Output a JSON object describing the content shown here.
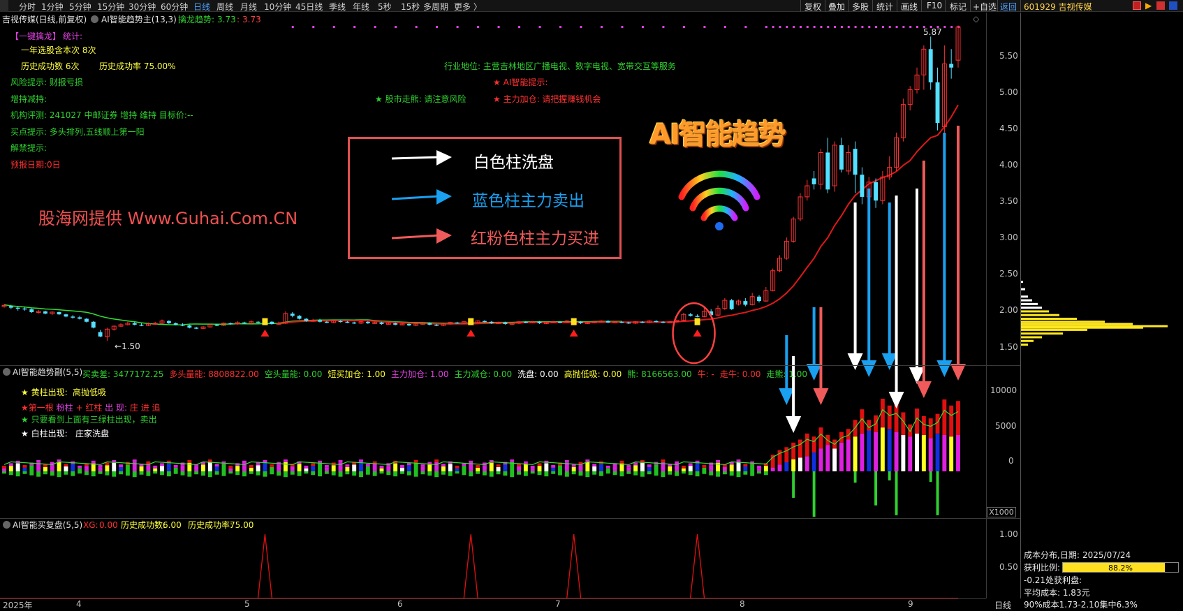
{
  "top_toolbar": {
    "periods": [
      "分时",
      "1分钟",
      "5分钟",
      "15分钟",
      "30分钟",
      "60分钟",
      "日线",
      "周线",
      "月线",
      "10分钟",
      "45日线",
      "季线",
      "年线",
      "5秒",
      "15秒",
      "多周期",
      "更多 〉"
    ],
    "active_period": "日线",
    "right_buttons": [
      "复权",
      "叠加",
      "多股",
      "统计",
      "画线",
      "F10",
      "标记",
      "+自选",
      "返回"
    ],
    "stock_code_name": "601929 吉视传媒"
  },
  "main_chart": {
    "title": "吉视传媒(日线,前复权)",
    "indicator": "AI智能趋势主(13,3)",
    "indicator_label": "擒龙趋势:",
    "indicator_val1": "3.73",
    "indicator_val2": "3.73",
    "high_label": "5.87",
    "low_label": "1.50",
    "y_ticks": [
      "5.50",
      "5.00",
      "4.50",
      "4.00",
      "3.50",
      "3.00",
      "2.50",
      "2.00",
      "1.50"
    ],
    "info_lines": {
      "oneclick": "【一键擒龙】",
      "stats": "统计:",
      "year_count": "一年选股含本次 8次",
      "success_count": "历史成功数 6次",
      "success_rate": "历史成功率 75.00%",
      "risk": "风险提示: 财报亏损",
      "holding": "增持减持:",
      "rating": "机构评测: 241027 中邮证券 增持 维持 目标价:--",
      "buy_tip": "买点提示: 多头排列,五线顺上第一阳",
      "unlock": "解禁提示:",
      "report": "预报日期:0日",
      "industry": "行业地位: 主营吉林地区广播电视、数字电视、宽带交互等服务",
      "ai_tip": "★ AI智能提示:",
      "trend": "★ 股市走熊: 请注意风险",
      "main_force": "★ 主力加仓: 请把握赚钱机会"
    },
    "watermark": "股海网提供 Www.Guhai.Com.CN",
    "big_title": "AI智能趋势",
    "legend": {
      "white": "白色柱洗盘",
      "blue": "蓝色柱主力卖出",
      "red": "红粉色柱主力买进"
    }
  },
  "sub_chart1": {
    "title": "AI智能趋势副(5,5)",
    "items": [
      {
        "label": "买卖差:",
        "value": "3477172.25",
        "color": "#30d030"
      },
      {
        "label": "多头量能:",
        "value": "8808822.00",
        "color": "#ff3030"
      },
      {
        "label": "空头量能:",
        "value": "0.00",
        "color": "#30d030"
      },
      {
        "label": "短买加仓:",
        "value": "1.00",
        "color": "#ffff30"
      },
      {
        "label": "主力加仓:",
        "value": "1.00",
        "color": "#e040e0"
      },
      {
        "label": "主力减仓:",
        "value": "0.00",
        "color": "#30d030"
      },
      {
        "label": "洗盘:",
        "value": "0.00",
        "color": "#ffffff"
      },
      {
        "label": "高抛低吸:",
        "value": "0.00",
        "color": "#ffff30"
      },
      {
        "label": "熊:",
        "value": "8166563.00",
        "color": "#30d030"
      },
      {
        "label": "牛:",
        "value": "-",
        "color": "#ff3030"
      },
      {
        "label": "走牛:",
        "value": "0.00",
        "color": "#ff3030"
      },
      {
        "label": "走熊:",
        "value": "1.00",
        "color": "#30d030"
      }
    ],
    "notes": {
      "n1_label": "★ 黄柱出现:",
      "n1_text": "高抛低吸",
      "n2_a": "★第一根",
      "n2_b": "粉柱",
      "n2_c": "+",
      "n2_d": "红柱",
      "n2_e": "出 现:",
      "n2_f": "庄",
      "n2_g": "进",
      "n2_h": "追",
      "n3": "★ 只要看到上面有三绿柱出现，卖出",
      "n4_label": "★ 白柱出现:",
      "n4_text": "庄家洗盘"
    },
    "y_ticks": [
      "10000",
      "5000",
      "0"
    ],
    "unit": "X1000"
  },
  "sub_chart2": {
    "title": "AI智能买复盘(5,5)",
    "xg_label": "XG:",
    "xg_value": "0.00",
    "succ_label": "历史成功数:",
    "succ_value": "6.00",
    "rate_label": "历史成功率:",
    "rate_value": "75.00",
    "y_ticks": [
      "1.00",
      "0.50"
    ]
  },
  "x_axis": {
    "labels": [
      "2025年",
      "4",
      "5",
      "6",
      "7",
      "8",
      "9"
    ],
    "period_button": "日线"
  },
  "right_panel": {
    "title_label": "成本分布,日期:",
    "date": "2025/07/24",
    "profit_label": "获利比例:",
    "profit_value": "88.2%",
    "profit_ratio": 0.882,
    "profit_price": "-0.21处获利盘:",
    "avg_cost": "平均成本: 1.83元",
    "cost90": "90%成本1.73-2.10集中6.3%"
  },
  "chart_data": {
    "type": "candlestick",
    "y_range": [
      1.3,
      5.95
    ],
    "candles": [
      [
        2.08,
        2.08,
        2.1,
        2.05
      ],
      [
        2.07,
        2.05,
        2.09,
        2.03
      ],
      [
        2.05,
        2.04,
        2.07,
        2.01
      ],
      [
        2.04,
        2.03,
        2.06,
        2.01
      ],
      [
        2.03,
        1.99,
        2.04,
        1.98
      ],
      [
        1.99,
        2.0,
        2.02,
        1.97
      ],
      [
        2.0,
        1.97,
        2.01,
        1.96
      ],
      [
        1.97,
        1.99,
        2.0,
        1.95
      ],
      [
        1.99,
        1.96,
        2.0,
        1.95
      ],
      [
        1.96,
        1.93,
        1.97,
        1.92
      ],
      [
        1.93,
        1.92,
        1.95,
        1.9
      ],
      [
        1.92,
        1.9,
        1.94,
        1.89
      ],
      [
        1.9,
        1.86,
        1.91,
        1.85
      ],
      [
        1.86,
        1.78,
        1.87,
        1.77
      ],
      [
        1.72,
        1.66,
        1.75,
        1.65
      ],
      [
        1.66,
        1.76,
        1.78,
        1.6
      ],
      [
        1.76,
        1.8,
        1.81,
        1.74
      ],
      [
        1.8,
        1.82,
        1.84,
        1.79
      ],
      [
        1.82,
        1.84,
        1.86,
        1.81
      ],
      [
        1.84,
        1.82,
        1.86,
        1.81
      ],
      [
        1.82,
        1.81,
        1.84,
        1.8
      ],
      [
        1.81,
        1.83,
        1.85,
        1.8
      ],
      [
        1.83,
        1.84,
        1.86,
        1.82
      ],
      [
        1.84,
        1.87,
        1.89,
        1.83
      ],
      [
        1.87,
        1.84,
        1.88,
        1.83
      ],
      [
        1.84,
        1.82,
        1.85,
        1.81
      ],
      [
        1.82,
        1.81,
        1.84,
        1.8
      ],
      [
        1.81,
        1.78,
        1.82,
        1.77
      ],
      [
        1.78,
        1.77,
        1.79,
        1.76
      ],
      [
        1.77,
        1.79,
        1.8,
        1.76
      ],
      [
        1.79,
        1.82,
        1.83,
        1.78
      ],
      [
        1.82,
        1.81,
        1.83,
        1.8
      ],
      [
        1.81,
        1.84,
        1.85,
        1.8
      ],
      [
        1.84,
        1.83,
        1.85,
        1.82
      ],
      [
        1.83,
        1.85,
        1.87,
        1.82
      ],
      [
        1.85,
        1.84,
        1.86,
        1.83
      ],
      [
        1.84,
        1.86,
        1.88,
        1.83
      ],
      [
        1.86,
        1.85,
        1.87,
        1.84
      ],
      [
        1.85,
        1.86,
        1.88,
        1.84
      ],
      [
        1.86,
        1.83,
        1.87,
        1.82
      ],
      [
        1.83,
        1.84,
        1.86,
        1.82
      ],
      [
        1.84,
        1.97,
        2.0,
        1.83
      ],
      [
        1.97,
        1.94,
        1.99,
        1.92
      ],
      [
        1.94,
        1.9,
        1.95,
        1.89
      ],
      [
        1.9,
        1.87,
        1.91,
        1.86
      ],
      [
        1.87,
        1.88,
        1.9,
        1.86
      ],
      [
        1.88,
        1.86,
        1.9,
        1.85
      ],
      [
        1.86,
        1.85,
        1.87,
        1.84
      ],
      [
        1.85,
        1.87,
        1.88,
        1.84
      ],
      [
        1.87,
        1.86,
        1.88,
        1.85
      ],
      [
        1.86,
        1.85,
        1.87,
        1.84
      ],
      [
        1.85,
        1.84,
        1.86,
        1.83
      ],
      [
        1.84,
        1.86,
        1.87,
        1.83
      ],
      [
        1.86,
        1.84,
        1.87,
        1.83
      ],
      [
        1.84,
        1.85,
        1.86,
        1.83
      ],
      [
        1.85,
        1.83,
        1.86,
        1.82
      ],
      [
        1.83,
        1.84,
        1.85,
        1.82
      ],
      [
        1.84,
        1.82,
        1.85,
        1.81
      ],
      [
        1.82,
        1.83,
        1.84,
        1.81
      ],
      [
        1.83,
        1.81,
        1.84,
        1.8
      ],
      [
        1.81,
        1.83,
        1.84,
        1.8
      ],
      [
        1.83,
        1.84,
        1.85,
        1.82
      ],
      [
        1.84,
        1.82,
        1.85,
        1.81
      ],
      [
        1.82,
        1.81,
        1.83,
        1.8
      ],
      [
        1.81,
        1.83,
        1.84,
        1.8
      ],
      [
        1.83,
        1.85,
        1.86,
        1.82
      ],
      [
        1.85,
        1.84,
        1.86,
        1.83
      ],
      [
        1.84,
        1.86,
        1.87,
        1.83
      ],
      [
        1.86,
        1.85,
        1.87,
        1.84
      ],
      [
        1.85,
        1.87,
        1.88,
        1.84
      ],
      [
        1.87,
        1.86,
        1.88,
        1.85
      ],
      [
        1.86,
        1.84,
        1.87,
        1.83
      ],
      [
        1.84,
        1.85,
        1.86,
        1.83
      ],
      [
        1.85,
        1.83,
        1.86,
        1.82
      ],
      [
        1.83,
        1.84,
        1.85,
        1.82
      ],
      [
        1.84,
        1.86,
        1.87,
        1.83
      ],
      [
        1.86,
        1.85,
        1.87,
        1.84
      ],
      [
        1.85,
        1.86,
        1.87,
        1.84
      ],
      [
        1.86,
        1.84,
        1.87,
        1.83
      ],
      [
        1.84,
        1.85,
        1.86,
        1.83
      ],
      [
        1.85,
        1.86,
        1.87,
        1.84
      ],
      [
        1.86,
        1.85,
        1.87,
        1.84
      ],
      [
        1.85,
        1.87,
        1.88,
        1.84
      ],
      [
        1.87,
        1.86,
        1.88,
        1.85
      ],
      [
        1.86,
        1.84,
        1.87,
        1.83
      ],
      [
        1.84,
        1.85,
        1.86,
        1.83
      ],
      [
        1.85,
        1.86,
        1.87,
        1.84
      ],
      [
        1.86,
        1.87,
        1.88,
        1.85
      ],
      [
        1.87,
        1.85,
        1.88,
        1.84
      ],
      [
        1.85,
        1.86,
        1.87,
        1.84
      ],
      [
        1.86,
        1.85,
        1.87,
        1.84
      ],
      [
        1.85,
        1.84,
        1.86,
        1.83
      ],
      [
        1.84,
        1.86,
        1.87,
        1.83
      ],
      [
        1.86,
        1.85,
        1.87,
        1.84
      ],
      [
        1.85,
        1.87,
        1.88,
        1.84
      ],
      [
        1.87,
        1.86,
        1.88,
        1.85
      ],
      [
        1.86,
        1.85,
        1.87,
        1.84
      ],
      [
        1.85,
        1.86,
        1.87,
        1.84
      ],
      [
        1.86,
        1.88,
        1.89,
        1.85
      ],
      [
        1.88,
        1.96,
        1.98,
        1.87
      ],
      [
        1.96,
        1.94,
        1.98,
        1.93
      ],
      [
        1.94,
        1.93,
        1.96,
        1.92
      ],
      [
        1.93,
        2.0,
        2.05,
        1.92
      ],
      [
        2.0,
        1.95,
        2.03,
        1.93
      ],
      [
        1.95,
        2.04,
        2.08,
        1.94
      ],
      [
        2.04,
        2.15,
        2.18,
        2.02
      ],
      [
        2.15,
        2.03,
        2.17,
        2.02
      ],
      [
        2.1,
        2.14,
        2.16,
        2.08
      ],
      [
        2.14,
        2.09,
        2.18,
        2.07
      ],
      [
        2.09,
        2.2,
        2.25,
        2.08
      ],
      [
        2.2,
        2.14,
        2.22,
        2.12
      ],
      [
        2.14,
        2.28,
        2.33,
        2.13
      ],
      [
        2.28,
        2.55,
        2.58,
        2.27
      ],
      [
        2.55,
        2.72,
        2.76,
        2.53
      ],
      [
        2.72,
        2.95,
        3.0,
        2.7
      ],
      [
        2.95,
        3.25,
        3.28,
        2.93
      ],
      [
        3.25,
        3.55,
        3.6,
        3.22
      ],
      [
        3.55,
        3.7,
        3.78,
        3.5
      ],
      [
        3.8,
        3.72,
        3.9,
        3.65
      ],
      [
        3.72,
        4.15,
        4.2,
        3.65
      ],
      [
        4.15,
        3.65,
        4.35,
        3.6
      ],
      [
        3.7,
        4.25,
        4.3,
        3.62
      ],
      [
        4.25,
        3.92,
        4.35,
        3.88
      ],
      [
        3.9,
        4.15,
        4.25,
        3.85
      ],
      [
        4.2,
        3.85,
        4.3,
        3.6
      ],
      [
        3.85,
        3.55,
        3.95,
        3.45
      ],
      [
        3.55,
        3.75,
        3.82,
        3.48
      ],
      [
        3.75,
        3.5,
        3.8,
        3.4
      ],
      [
        3.5,
        3.82,
        3.9,
        3.45
      ],
      [
        3.82,
        3.95,
        4.1,
        3.78
      ],
      [
        3.95,
        4.35,
        4.42,
        3.9
      ],
      [
        4.35,
        4.8,
        4.88,
        4.3
      ],
      [
        4.8,
        5.0,
        5.05,
        4.72
      ],
      [
        5.0,
        5.2,
        5.3,
        4.95
      ],
      [
        5.2,
        5.55,
        5.6,
        5.0
      ],
      [
        5.55,
        5.1,
        5.72,
        5.0
      ],
      [
        5.1,
        4.55,
        5.3,
        4.45
      ],
      [
        4.5,
        5.35,
        5.6,
        4.4
      ],
      [
        5.35,
        5.3,
        5.55,
        5.15
      ],
      [
        5.4,
        5.85,
        5.87,
        5.3
      ]
    ],
    "ma_red_start": 40,
    "sub1": {
      "y_range": [
        -6000,
        12000
      ],
      "tail": [
        [
          500,
          2200,
          0
        ],
        [
          900,
          2800,
          0
        ],
        [
          1200,
          3200,
          0
        ],
        [
          1600,
          3800,
          -3500
        ],
        [
          1800,
          4200,
          0
        ],
        [
          2000,
          5000,
          0
        ],
        [
          2500,
          4600,
          -6000
        ],
        [
          3000,
          5800,
          0
        ],
        [
          3500,
          4800,
          0
        ],
        [
          3000,
          4200,
          0
        ],
        [
          3800,
          5200,
          0
        ],
        [
          4200,
          5600,
          0
        ],
        [
          4600,
          6800,
          -1500
        ],
        [
          5000,
          8200,
          0
        ],
        [
          5400,
          6800,
          0
        ],
        [
          5200,
          7400,
          -4500
        ],
        [
          5800,
          9600,
          0
        ],
        [
          5600,
          8700,
          -1200
        ],
        [
          5200,
          9000,
          -5800
        ],
        [
          4800,
          7800,
          0
        ],
        [
          4600,
          6200,
          0
        ],
        [
          5000,
          8300,
          0
        ],
        [
          4800,
          7300,
          0
        ],
        [
          4400,
          7000,
          -1400
        ],
        [
          5000,
          7600,
          -5800
        ],
        [
          4800,
          9500,
          0
        ],
        [
          4600,
          8700,
          0
        ],
        [
          4800,
          9300,
          0
        ]
      ],
      "tail_colors": [
        "#e020e0",
        "#e020e0",
        "#1030e0",
        "#ffff20",
        "#ffffff",
        "#e020e0",
        "#1030e0",
        "#e020e0",
        "#e020e0",
        "#ffffff",
        "#e020e0",
        "#e020e0",
        "#ffff20",
        "#e020e0",
        "#1030e0",
        "#e020e0",
        "#ffff20",
        "#1030e0",
        "#e020e0",
        "#ffffff",
        "#e020e0",
        "#ffffff",
        "#ffff20",
        "#e020e0",
        "#1030e0",
        "#e020e0",
        "#ffff20",
        "#e020e0"
      ]
    },
    "sub2_spikes": [
      38,
      68,
      83,
      101
    ]
  }
}
